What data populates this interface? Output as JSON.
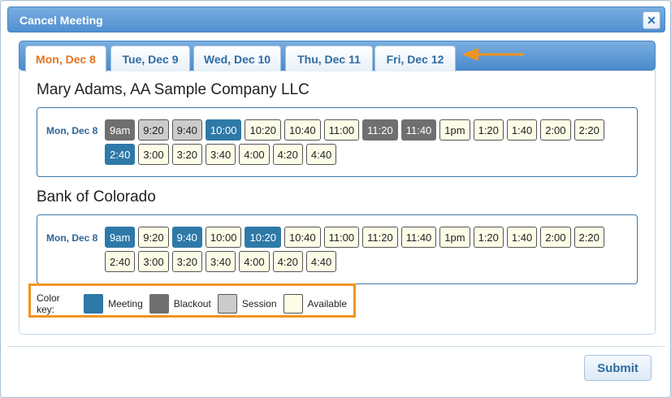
{
  "dialog": {
    "title": "Cancel Meeting",
    "close_symbol": "✕"
  },
  "tabs": [
    {
      "label": "Mon, Dec 8",
      "active": true
    },
    {
      "label": "Tue, Dec 9",
      "active": false
    },
    {
      "label": "Wed, Dec 10",
      "active": false
    },
    {
      "label": "Thu, Dec 11",
      "active": false
    },
    {
      "label": "Fri, Dec 12",
      "active": false
    }
  ],
  "companies": [
    {
      "name": "Mary Adams, AA Sample Company LLC",
      "date_label": "Mon, Dec 8",
      "slots": [
        {
          "time": "9am",
          "status": "blackout"
        },
        {
          "time": "9:20",
          "status": "session"
        },
        {
          "time": "9:40",
          "status": "session"
        },
        {
          "time": "10:00",
          "status": "meeting"
        },
        {
          "time": "10:20",
          "status": "available"
        },
        {
          "time": "10:40",
          "status": "available"
        },
        {
          "time": "11:00",
          "status": "available"
        },
        {
          "time": "11:20",
          "status": "blackout"
        },
        {
          "time": "11:40",
          "status": "blackout"
        },
        {
          "time": "1pm",
          "status": "available"
        },
        {
          "time": "1:20",
          "status": "available"
        },
        {
          "time": "1:40",
          "status": "available"
        },
        {
          "time": "2:00",
          "status": "available"
        },
        {
          "time": "2:20",
          "status": "available"
        },
        {
          "time": "2:40",
          "status": "meeting"
        },
        {
          "time": "3:00",
          "status": "available"
        },
        {
          "time": "3:20",
          "status": "available"
        },
        {
          "time": "3:40",
          "status": "available"
        },
        {
          "time": "4:00",
          "status": "available"
        },
        {
          "time": "4:20",
          "status": "available"
        },
        {
          "time": "4:40",
          "status": "available"
        }
      ]
    },
    {
      "name": "Bank of Colorado",
      "date_label": "Mon, Dec 8",
      "slots": [
        {
          "time": "9am",
          "status": "meeting"
        },
        {
          "time": "9:20",
          "status": "available"
        },
        {
          "time": "9:40",
          "status": "meeting"
        },
        {
          "time": "10:00",
          "status": "available"
        },
        {
          "time": "10:20",
          "status": "meeting"
        },
        {
          "time": "10:40",
          "status": "available"
        },
        {
          "time": "11:00",
          "status": "available"
        },
        {
          "time": "11:20",
          "status": "available"
        },
        {
          "time": "11:40",
          "status": "available"
        },
        {
          "time": "1pm",
          "status": "available"
        },
        {
          "time": "1:20",
          "status": "available"
        },
        {
          "time": "1:40",
          "status": "available"
        },
        {
          "time": "2:00",
          "status": "available"
        },
        {
          "time": "2:20",
          "status": "available"
        },
        {
          "time": "2:40",
          "status": "available"
        },
        {
          "time": "3:00",
          "status": "available"
        },
        {
          "time": "3:20",
          "status": "available"
        },
        {
          "time": "3:40",
          "status": "available"
        },
        {
          "time": "4:00",
          "status": "available"
        },
        {
          "time": "4:20",
          "status": "available"
        },
        {
          "time": "4:40",
          "status": "available"
        }
      ]
    }
  ],
  "color_key": {
    "label": "Color key:",
    "items": [
      {
        "label": "Meeting",
        "status": "meeting"
      },
      {
        "label": "Blackout",
        "status": "blackout"
      },
      {
        "label": "Session",
        "status": "session"
      },
      {
        "label": "Available",
        "status": "available"
      }
    ]
  },
  "colors": {
    "meeting": "#2e79a8",
    "blackout": "#6f6f6f",
    "session": "#cccccc",
    "available": "#fdfde7",
    "active_tab_text": "#e5731e",
    "highlight": "#f2941e"
  },
  "footer": {
    "submit_label": "Submit"
  }
}
